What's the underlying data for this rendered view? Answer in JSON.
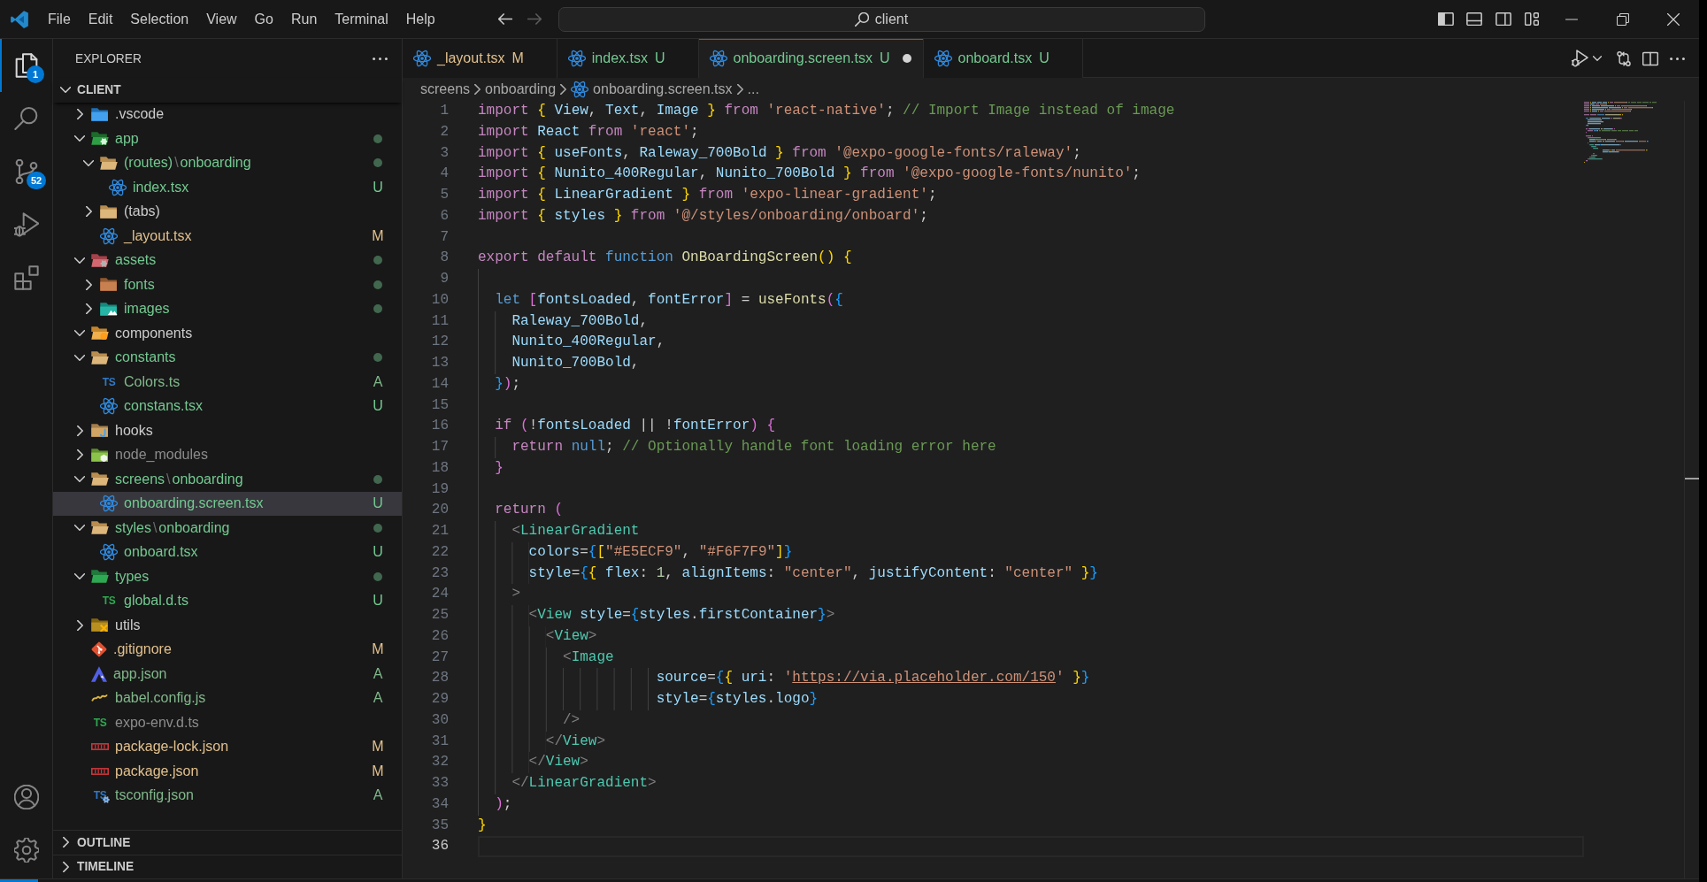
{
  "title_bar": {
    "menu": [
      "File",
      "Edit",
      "Selection",
      "View",
      "Go",
      "Run",
      "Terminal",
      "Help"
    ],
    "nav": [
      {
        "kind": "back",
        "disabled": false
      },
      {
        "kind": "forward",
        "disabled": true
      }
    ],
    "command_center": "client",
    "layout_toggles": [
      {
        "kind": "primary-sidebar",
        "on": true
      },
      {
        "kind": "panel",
        "on": false
      },
      {
        "kind": "secondary-sidebar",
        "on": false
      }
    ]
  },
  "activity_bar": {
    "items": [
      {
        "kind": "explorer",
        "selected": true,
        "badge": "1"
      },
      {
        "kind": "search",
        "selected": false
      },
      {
        "kind": "source-control",
        "selected": false,
        "badge": "52"
      },
      {
        "kind": "run-debug",
        "selected": false
      },
      {
        "kind": "extensions",
        "selected": false
      }
    ],
    "bottom": [
      {
        "kind": "accounts"
      },
      {
        "kind": "manage"
      }
    ]
  },
  "sidebar": {
    "title": "EXPLORER",
    "section": {
      "title": "CLIENT",
      "expanded": true
    },
    "tree": [
      {
        "label": ".vscode",
        "kind": "folder-vscode",
        "expanded": false,
        "color": "#cccccc",
        "changes": false,
        "selected": false
      },
      {
        "label": "app",
        "kind": "folder-app",
        "expanded": true,
        "color": "#73c991",
        "changes": true,
        "selected": false,
        "children": [
          {
            "label": "(routes)",
            "separator": "\\",
            "compact_label": "onboarding",
            "kind": "folder",
            "expanded": true,
            "color": "#73c991",
            "changes": true,
            "selected": false,
            "children": [
              {
                "label": "index.tsx",
                "kind": "react",
                "color": "#73c991",
                "badge": "U",
                "selected": false
              }
            ]
          },
          {
            "label": "(tabs)",
            "kind": "folder",
            "expanded": false,
            "color": "#cccccc",
            "changes": false,
            "selected": false
          },
          {
            "label": "_layout.tsx",
            "kind": "react",
            "color": "#e2c08d",
            "badge": "M",
            "selected": false
          }
        ]
      },
      {
        "label": "assets",
        "kind": "folder-assets",
        "expanded": true,
        "color": "#73c991",
        "changes": true,
        "selected": false,
        "children": [
          {
            "label": "fonts",
            "kind": "folder-fonts",
            "expanded": false,
            "color": "#73c991",
            "changes": true,
            "selected": false
          },
          {
            "label": "images",
            "kind": "folder-images",
            "expanded": false,
            "color": "#73c991",
            "changes": true,
            "selected": false
          }
        ]
      },
      {
        "label": "components",
        "kind": "folder-components",
        "expanded": true,
        "color": "#cccccc",
        "changes": false,
        "selected": false
      },
      {
        "label": "constants",
        "kind": "folder",
        "expanded": true,
        "color": "#73c991",
        "changes": true,
        "selected": false,
        "children": [
          {
            "label": "Colors.ts",
            "kind": "typescript",
            "icon_text": "TS",
            "color": "#81b88b",
            "badge": "A",
            "selected": false
          },
          {
            "label": "constans.tsx",
            "kind": "react",
            "color": "#73c991",
            "badge": "U",
            "selected": false
          }
        ]
      },
      {
        "label": "hooks",
        "kind": "folder-hooks",
        "expanded": false,
        "color": "#cccccc",
        "changes": false,
        "selected": false
      },
      {
        "label": "node_modules",
        "kind": "folder-node",
        "expanded": false,
        "color": "#8c8c8c",
        "changes": false,
        "selected": false
      },
      {
        "label": "screens",
        "separator": "\\",
        "compact_label": "onboarding",
        "kind": "folder",
        "expanded": true,
        "color": "#73c991",
        "changes": true,
        "selected": false,
        "children": [
          {
            "label": "onboarding.screen.tsx",
            "kind": "react",
            "color": "#73c991",
            "badge": "U",
            "selected": true
          }
        ]
      },
      {
        "label": "styles",
        "separator": "\\",
        "compact_label": "onboarding",
        "kind": "folder",
        "expanded": true,
        "color": "#73c991",
        "changes": true,
        "selected": false,
        "children": [
          {
            "label": "onboard.tsx",
            "kind": "react",
            "color": "#73c991",
            "badge": "U",
            "selected": false
          }
        ]
      },
      {
        "label": "types",
        "kind": "folder-types",
        "expanded": true,
        "color": "#73c991",
        "changes": true,
        "selected": false,
        "children": [
          {
            "label": "global.d.ts",
            "kind": "typescript-def",
            "icon_text": "TS",
            "color": "#73c991",
            "badge": "U",
            "selected": false
          }
        ]
      },
      {
        "label": "utils",
        "kind": "folder-utils",
        "expanded": false,
        "color": "#cccccc",
        "changes": false,
        "selected": false
      },
      {
        "label": ".gitignore",
        "kind": "git",
        "color": "#e2c08d",
        "badge": "M",
        "selected": false
      },
      {
        "label": "app.json",
        "kind": "expo",
        "color": "#81b88b",
        "badge": "A",
        "selected": false
      },
      {
        "label": "babel.config.js",
        "kind": "babel",
        "color": "#81b88b",
        "badge": "A",
        "selected": false
      },
      {
        "label": "expo-env.d.ts",
        "kind": "typescript-def",
        "icon_text": "TS",
        "color": "#8c8c8c",
        "selected": false
      },
      {
        "label": "package-lock.json",
        "kind": "npm",
        "color": "#e2c08d",
        "badge": "M",
        "selected": false
      },
      {
        "label": "package.json",
        "kind": "npm",
        "color": "#e2c08d",
        "badge": "M",
        "selected": false
      },
      {
        "label": "tsconfig.json",
        "kind": "tsconfig",
        "icon_text": "TS",
        "color": "#81b88b",
        "badge": "A",
        "selected": false
      }
    ],
    "panels": [
      {
        "title": "OUTLINE",
        "expanded": false
      },
      {
        "title": "TIMELINE",
        "expanded": false
      }
    ]
  },
  "editor": {
    "tabs": [
      {
        "label": "_layout.tsx",
        "badge": "M",
        "kind": "react",
        "color": "#e2c08d",
        "selected": false,
        "dirty": false
      },
      {
        "label": "index.tsx",
        "badge": "U",
        "kind": "react",
        "color": "#73c991",
        "selected": false,
        "dirty": false
      },
      {
        "label": "onboarding.screen.tsx",
        "badge": "U",
        "kind": "react",
        "color": "#73c991",
        "selected": true,
        "dirty": true
      },
      {
        "label": "onboard.tsx",
        "badge": "U",
        "kind": "react",
        "color": "#73c991",
        "selected": false,
        "dirty": false
      }
    ],
    "breadcrumbs": [
      {
        "label": "screens",
        "kind": "folder"
      },
      {
        "label": "onboarding",
        "kind": "folder"
      },
      {
        "label": "onboarding.screen.tsx",
        "kind": "react"
      },
      {
        "label": "...",
        "kind": "more"
      }
    ],
    "lines": [
      {
        "number": "1",
        "current": false,
        "tokens": [
          {
            "kind": "control",
            "text": "import "
          },
          {
            "kind": "bracket-1",
            "text": "{"
          },
          {
            "kind": "variable",
            "text": " View"
          },
          {
            "kind": "punctuation",
            "text": ", "
          },
          {
            "kind": "variable",
            "text": "Text"
          },
          {
            "kind": "punctuation",
            "text": ", "
          },
          {
            "kind": "variable",
            "text": "Image "
          },
          {
            "kind": "bracket-1",
            "text": "}"
          },
          {
            "kind": "control",
            "text": " from "
          },
          {
            "kind": "string",
            "text": "'react-native'"
          },
          {
            "kind": "punctuation",
            "text": "; "
          },
          {
            "kind": "comment",
            "text": "// Import Image instead of image"
          }
        ]
      },
      {
        "number": "2",
        "current": false,
        "tokens": [
          {
            "kind": "control",
            "text": "import "
          },
          {
            "kind": "variable",
            "text": "React "
          },
          {
            "kind": "control",
            "text": "from "
          },
          {
            "kind": "string",
            "text": "'react'"
          },
          {
            "kind": "punctuation",
            "text": ";"
          }
        ]
      },
      {
        "number": "3",
        "current": false,
        "tokens": [
          {
            "kind": "control",
            "text": "import "
          },
          {
            "kind": "bracket-1",
            "text": "{"
          },
          {
            "kind": "variable",
            "text": " useFonts"
          },
          {
            "kind": "punctuation",
            "text": ", "
          },
          {
            "kind": "variable",
            "text": "Raleway_700Bold "
          },
          {
            "kind": "bracket-1",
            "text": "}"
          },
          {
            "kind": "control",
            "text": " from "
          },
          {
            "kind": "string",
            "text": "'@expo-google-fonts/raleway'"
          },
          {
            "kind": "punctuation",
            "text": ";"
          }
        ]
      },
      {
        "number": "4",
        "current": false,
        "tokens": [
          {
            "kind": "control",
            "text": "import "
          },
          {
            "kind": "bracket-1",
            "text": "{"
          },
          {
            "kind": "variable",
            "text": " Nunito_400Regular"
          },
          {
            "kind": "punctuation",
            "text": ", "
          },
          {
            "kind": "variable",
            "text": "Nunito_700Bold "
          },
          {
            "kind": "bracket-1",
            "text": "}"
          },
          {
            "kind": "control",
            "text": " from "
          },
          {
            "kind": "string",
            "text": "'@expo-google-fonts/nunito'"
          },
          {
            "kind": "punctuation",
            "text": ";"
          }
        ]
      },
      {
        "number": "5",
        "current": false,
        "tokens": [
          {
            "kind": "control",
            "text": "import "
          },
          {
            "kind": "bracket-1",
            "text": "{"
          },
          {
            "kind": "variable",
            "text": " LinearGradient "
          },
          {
            "kind": "bracket-1",
            "text": "}"
          },
          {
            "kind": "control",
            "text": " from "
          },
          {
            "kind": "string",
            "text": "'expo-linear-gradient'"
          },
          {
            "kind": "punctuation",
            "text": ";"
          }
        ]
      },
      {
        "number": "6",
        "current": false,
        "tokens": [
          {
            "kind": "control",
            "text": "import "
          },
          {
            "kind": "bracket-1",
            "text": "{"
          },
          {
            "kind": "variable",
            "text": " styles "
          },
          {
            "kind": "bracket-1",
            "text": "}"
          },
          {
            "kind": "control",
            "text": " from "
          },
          {
            "kind": "string",
            "text": "'@/styles/onboarding/onboard'"
          },
          {
            "kind": "punctuation",
            "text": ";"
          }
        ]
      },
      {
        "number": "7",
        "current": false
      },
      {
        "number": "8",
        "current": false,
        "tokens": [
          {
            "kind": "control",
            "text": "export default "
          },
          {
            "kind": "keyword",
            "text": "function "
          },
          {
            "kind": "function",
            "text": "OnBoardingScreen"
          },
          {
            "kind": "bracket-1",
            "text": "() {"
          }
        ]
      },
      {
        "number": "9",
        "current": false
      },
      {
        "number": "10",
        "current": false,
        "tokens": [
          {
            "kind": "keyword",
            "text": "  let "
          },
          {
            "kind": "bracket-2",
            "text": "["
          },
          {
            "kind": "variable",
            "text": "fontsLoaded"
          },
          {
            "kind": "punctuation",
            "text": ", "
          },
          {
            "kind": "variable",
            "text": "fontError"
          },
          {
            "kind": "bracket-2",
            "text": "]"
          },
          {
            "kind": "punctuation",
            "text": " = "
          },
          {
            "kind": "function",
            "text": "useFonts"
          },
          {
            "kind": "bracket-2",
            "text": "("
          },
          {
            "kind": "bracket-3",
            "text": "{"
          }
        ]
      },
      {
        "number": "11",
        "current": false,
        "tokens": [
          {
            "kind": "variable",
            "text": "    Raleway_700Bold"
          },
          {
            "kind": "punctuation",
            "text": ","
          }
        ]
      },
      {
        "number": "12",
        "current": false,
        "tokens": [
          {
            "kind": "variable",
            "text": "    Nunito_400Regular"
          },
          {
            "kind": "punctuation",
            "text": ","
          }
        ]
      },
      {
        "number": "13",
        "current": false,
        "tokens": [
          {
            "kind": "variable",
            "text": "    Nunito_700Bold"
          },
          {
            "kind": "punctuation",
            "text": ","
          }
        ]
      },
      {
        "number": "14",
        "current": false,
        "tokens": [
          {
            "kind": "bracket-3",
            "text": "  }"
          },
          {
            "kind": "bracket-2",
            "text": ")"
          },
          {
            "kind": "punctuation",
            "text": ";"
          }
        ]
      },
      {
        "number": "15",
        "current": false
      },
      {
        "number": "16",
        "current": false,
        "tokens": [
          {
            "kind": "control",
            "text": "  if "
          },
          {
            "kind": "bracket-2",
            "text": "("
          },
          {
            "kind": "punctuation",
            "text": "!"
          },
          {
            "kind": "variable",
            "text": "fontsLoaded"
          },
          {
            "kind": "punctuation",
            "text": " || !"
          },
          {
            "kind": "variable",
            "text": "fontError"
          },
          {
            "kind": "bracket-2",
            "text": ") {"
          }
        ]
      },
      {
        "number": "17",
        "current": false,
        "tokens": [
          {
            "kind": "control",
            "text": "    return "
          },
          {
            "kind": "keyword",
            "text": "null"
          },
          {
            "kind": "punctuation",
            "text": "; "
          },
          {
            "kind": "comment",
            "text": "// Optionally handle font loading error here"
          }
        ]
      },
      {
        "number": "18",
        "current": false,
        "tokens": [
          {
            "kind": "bracket-2",
            "text": "  }"
          }
        ]
      },
      {
        "number": "19",
        "current": false
      },
      {
        "number": "20",
        "current": false,
        "tokens": [
          {
            "kind": "control",
            "text": "  return "
          },
          {
            "kind": "bracket-2",
            "text": "("
          }
        ]
      },
      {
        "number": "21",
        "current": false,
        "tokens": [
          {
            "kind": "tag-bracket",
            "text": "    <"
          },
          {
            "kind": "tag",
            "text": "LinearGradient"
          }
        ]
      },
      {
        "number": "22",
        "current": false,
        "tokens": [
          {
            "kind": "variable",
            "text": "      colors"
          },
          {
            "kind": "punctuation",
            "text": "="
          },
          {
            "kind": "bracket-3",
            "text": "{"
          },
          {
            "kind": "bracket-1",
            "text": "["
          },
          {
            "kind": "string",
            "text": "\"#E5ECF9\""
          },
          {
            "kind": "punctuation",
            "text": ", "
          },
          {
            "kind": "string",
            "text": "\"#F6F7F9\""
          },
          {
            "kind": "bracket-1",
            "text": "]"
          },
          {
            "kind": "bracket-3",
            "text": "}"
          }
        ]
      },
      {
        "number": "23",
        "current": false,
        "tokens": [
          {
            "kind": "variable",
            "text": "      style"
          },
          {
            "kind": "punctuation",
            "text": "="
          },
          {
            "kind": "bracket-3",
            "text": "{"
          },
          {
            "kind": "bracket-1",
            "text": "{"
          },
          {
            "kind": "variable",
            "text": " flex"
          },
          {
            "kind": "punctuation",
            "text": ": "
          },
          {
            "kind": "number",
            "text": "1"
          },
          {
            "kind": "punctuation",
            "text": ", "
          },
          {
            "kind": "variable",
            "text": "alignItems"
          },
          {
            "kind": "punctuation",
            "text": ": "
          },
          {
            "kind": "string",
            "text": "\"center\""
          },
          {
            "kind": "punctuation",
            "text": ", "
          },
          {
            "kind": "variable",
            "text": "justifyContent"
          },
          {
            "kind": "punctuation",
            "text": ": "
          },
          {
            "kind": "string",
            "text": "\"center\""
          },
          {
            "kind": "bracket-1",
            "text": " }"
          },
          {
            "kind": "bracket-3",
            "text": "}"
          }
        ]
      },
      {
        "number": "24",
        "current": false,
        "tokens": [
          {
            "kind": "tag-bracket",
            "text": "    >"
          }
        ]
      },
      {
        "number": "25",
        "current": false,
        "tokens": [
          {
            "kind": "tag-bracket",
            "text": "      <"
          },
          {
            "kind": "tag",
            "text": "View"
          },
          {
            "kind": "variable",
            "text": " style"
          },
          {
            "kind": "punctuation",
            "text": "="
          },
          {
            "kind": "bracket-3",
            "text": "{"
          },
          {
            "kind": "variable",
            "text": "styles"
          },
          {
            "kind": "punctuation",
            "text": "."
          },
          {
            "kind": "variable",
            "text": "firstContainer"
          },
          {
            "kind": "bracket-3",
            "text": "}"
          },
          {
            "kind": "tag-bracket",
            "text": ">"
          }
        ]
      },
      {
        "number": "26",
        "current": false,
        "tokens": [
          {
            "kind": "tag-bracket",
            "text": "        <"
          },
          {
            "kind": "tag",
            "text": "View"
          },
          {
            "kind": "tag-bracket",
            "text": ">"
          }
        ]
      },
      {
        "number": "27",
        "current": false,
        "tokens": [
          {
            "kind": "tag-bracket",
            "text": "          <"
          },
          {
            "kind": "tag",
            "text": "Image"
          }
        ]
      },
      {
        "number": "28",
        "current": false,
        "tokens": [
          {
            "kind": "variable",
            "text": "                     source"
          },
          {
            "kind": "punctuation",
            "text": "="
          },
          {
            "kind": "bracket-3",
            "text": "{"
          },
          {
            "kind": "bracket-1",
            "text": "{"
          },
          {
            "kind": "variable",
            "text": " uri"
          },
          {
            "kind": "punctuation",
            "text": ": "
          },
          {
            "kind": "string",
            "text": "'"
          },
          {
            "kind": "link",
            "text": "https://via.placeholder.com/150"
          },
          {
            "kind": "string",
            "text": "'"
          },
          {
            "kind": "bracket-1",
            "text": " }"
          },
          {
            "kind": "bracket-3",
            "text": "}"
          }
        ]
      },
      {
        "number": "29",
        "current": false,
        "tokens": [
          {
            "kind": "variable",
            "text": "                     style"
          },
          {
            "kind": "punctuation",
            "text": "="
          },
          {
            "kind": "bracket-3",
            "text": "{"
          },
          {
            "kind": "variable",
            "text": "styles"
          },
          {
            "kind": "punctuation",
            "text": "."
          },
          {
            "kind": "variable",
            "text": "logo"
          },
          {
            "kind": "bracket-3",
            "text": "}"
          }
        ]
      },
      {
        "number": "30",
        "current": false,
        "tokens": [
          {
            "kind": "tag-bracket",
            "text": "          />"
          }
        ]
      },
      {
        "number": "31",
        "current": false,
        "tokens": [
          {
            "kind": "tag-bracket",
            "text": "        </"
          },
          {
            "kind": "tag",
            "text": "View"
          },
          {
            "kind": "tag-bracket",
            "text": ">"
          }
        ]
      },
      {
        "number": "32",
        "current": false,
        "tokens": [
          {
            "kind": "tag-bracket",
            "text": "      </"
          },
          {
            "kind": "tag",
            "text": "View"
          },
          {
            "kind": "tag-bracket",
            "text": ">"
          }
        ]
      },
      {
        "number": "33",
        "current": false,
        "tokens": [
          {
            "kind": "tag-bracket",
            "text": "    </"
          },
          {
            "kind": "tag",
            "text": "LinearGradient"
          },
          {
            "kind": "tag-bracket",
            "text": ">"
          }
        ]
      },
      {
        "number": "34",
        "current": false,
        "tokens": [
          {
            "kind": "bracket-2",
            "text": "  )"
          },
          {
            "kind": "punctuation",
            "text": ";"
          }
        ]
      },
      {
        "number": "35",
        "current": false,
        "tokens": [
          {
            "kind": "bracket-1",
            "text": "}"
          }
        ]
      },
      {
        "number": "36",
        "current": true
      }
    ]
  }
}
